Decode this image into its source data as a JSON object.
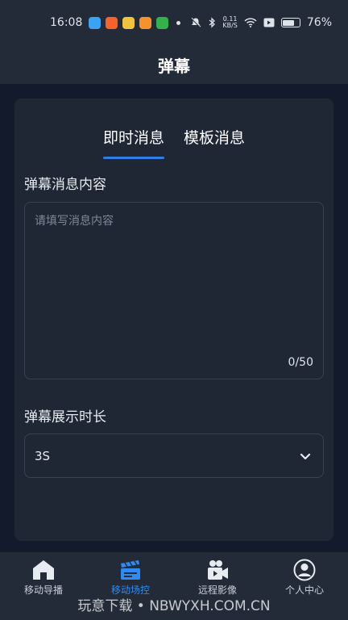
{
  "status_bar": {
    "time": "16:08",
    "net_speed_value": "0.11",
    "net_speed_unit": "KB/S",
    "battery_pct": "76%",
    "battery_level": 0.76,
    "app_icon_colors": [
      "#3ba3f5",
      "#f5632b",
      "#f2c33c",
      "#f5922b",
      "#34b24a"
    ]
  },
  "header": {
    "title": "弹幕"
  },
  "tabs": [
    {
      "label": "即时消息",
      "active": true
    },
    {
      "label": "模板消息",
      "active": false
    }
  ],
  "message_section": {
    "label": "弹幕消息内容",
    "placeholder": "请填写消息内容",
    "value": "",
    "counter": "0/50"
  },
  "duration_section": {
    "label": "弹幕展示时长",
    "selected": "3S"
  },
  "bottom_nav": [
    {
      "label": "移动导播",
      "icon": "home-icon",
      "active": false
    },
    {
      "label": "移动场控",
      "icon": "clapperboard-icon",
      "active": true
    },
    {
      "label": "远程影像",
      "icon": "video-camera-icon",
      "active": false
    },
    {
      "label": "个人中心",
      "icon": "user-icon",
      "active": false
    }
  ],
  "watermark": "玩意下载 • NBWYXH.COM.CN",
  "colors": {
    "accent": "#2f7ee6",
    "background": "#131a2b",
    "card": "#1f2735",
    "bar": "#232b38"
  }
}
